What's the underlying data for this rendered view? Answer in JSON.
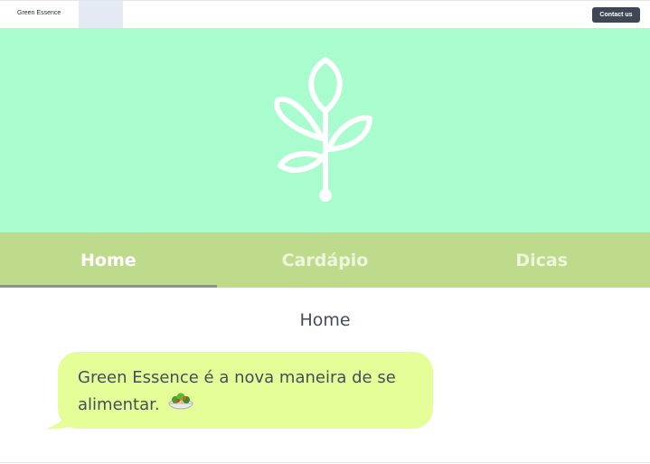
{
  "topbar": {
    "brand": "Green Essence",
    "contact_label": "Contact us"
  },
  "hero": {
    "icon": "plant-sprout-icon",
    "background_color": "#a8fcce"
  },
  "nav": {
    "background_color": "#bedb8c",
    "tabs": [
      {
        "label": "Home",
        "active": true
      },
      {
        "label": "Cardápio",
        "active": false
      },
      {
        "label": "Dicas",
        "active": false
      }
    ]
  },
  "main": {
    "title": "Home",
    "message": "Green Essence é a nova maneira de se alimentar.",
    "message_emoji": "salad-bowl-icon",
    "bubble_color": "#e6fe98"
  }
}
